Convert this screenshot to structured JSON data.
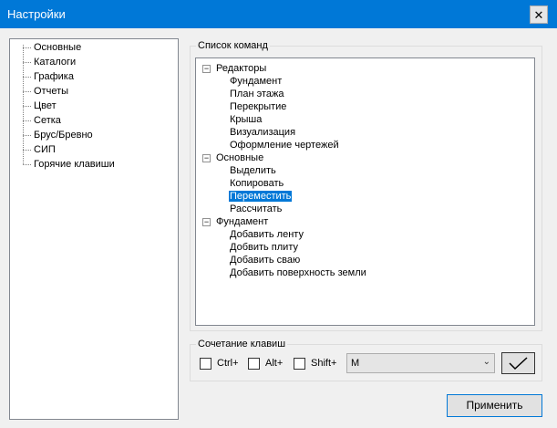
{
  "window": {
    "title": "Настройки",
    "close_glyph": "✕"
  },
  "nav": {
    "items": [
      {
        "label": "Основные"
      },
      {
        "label": "Каталоги"
      },
      {
        "label": "Графика"
      },
      {
        "label": "Отчеты"
      },
      {
        "label": "Цвет"
      },
      {
        "label": "Сетка"
      },
      {
        "label": "Брус/Бревно"
      },
      {
        "label": "СИП"
      },
      {
        "label": "Горячие клавиши"
      }
    ]
  },
  "commands": {
    "group_label": "Список команд",
    "groups": [
      {
        "label": "Редакторы",
        "expander": "−",
        "items": [
          "Фундамент",
          "План этажа",
          "Перекрытие",
          "Крыша",
          "Визуализация",
          "Оформление чертежей"
        ]
      },
      {
        "label": "Основные",
        "expander": "−",
        "items": [
          "Выделить",
          "Копировать",
          "Переместить",
          "Рассчитать"
        ]
      },
      {
        "label": "Фундамент",
        "expander": "−",
        "items": [
          "Добавить ленту",
          "Добвить плиту",
          "Добавить сваю",
          "Добавить поверхность земли"
        ]
      }
    ],
    "selected": "Переместить"
  },
  "shortcut": {
    "group_label": "Сочетание клавиш",
    "ctrl_label": "Ctrl+",
    "alt_label": "Alt+",
    "shift_label": "Shift+",
    "key_value": "M",
    "dropdown_arrow": "⌄"
  },
  "buttons": {
    "apply_label": "Применить"
  }
}
